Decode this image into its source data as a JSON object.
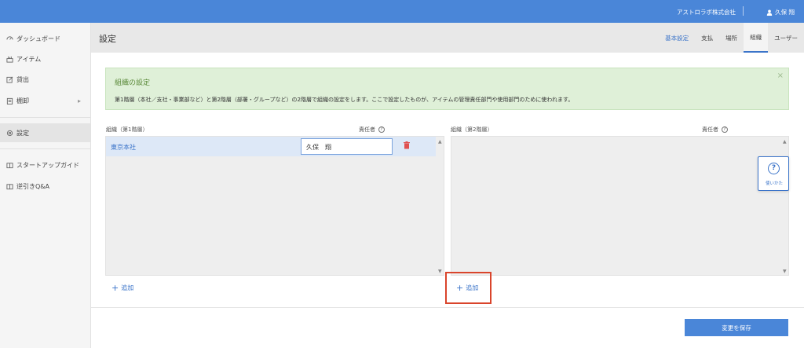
{
  "topbar": {
    "company": "アストロラボ株式会社",
    "user": "久保 翔"
  },
  "sidebar": {
    "items": [
      {
        "label": "ダッシュボード",
        "icon": "dashboard-icon"
      },
      {
        "label": "アイテム",
        "icon": "item-icon"
      },
      {
        "label": "貸出",
        "icon": "edit-icon"
      },
      {
        "label": "棚卸",
        "icon": "clipboard-icon",
        "has_arrow": true
      },
      {
        "label": "設定",
        "icon": "gear-icon",
        "active": true
      },
      {
        "label": "スタートアップガイド",
        "icon": "book-icon"
      },
      {
        "label": "逆引きQ&A",
        "icon": "book-icon"
      }
    ]
  },
  "header": {
    "title": "設定",
    "tabs": [
      {
        "label": "基本設定"
      },
      {
        "label": "支払"
      },
      {
        "label": "場所"
      },
      {
        "label": "組織",
        "active": true
      },
      {
        "label": "ユーザー"
      }
    ]
  },
  "alert": {
    "title": "組織の設定",
    "text": "第1階層（本社／支社・事業部など）と第2階層（部署・グループなど）の2階層で組織の設定をします。ここで設定したものが、アイテムの管理責任部門や使用部門のために使われます。",
    "close": "×"
  },
  "level1": {
    "org_header": "組織（第1階層）",
    "owner_header": "責任者",
    "rows": [
      {
        "name": "東京本社",
        "owner": "久保　翔"
      }
    ],
    "add_label": "追加"
  },
  "level2": {
    "org_header": "組織（第2階層）",
    "owner_header": "責任者",
    "add_label": "追加"
  },
  "help_widget": {
    "label": "使いかた",
    "glyph": "?"
  },
  "save_button": "変更を保存",
  "colors": {
    "primary": "#4a86d8",
    "success_bg": "#dff0d8",
    "highlight": "#d9442b"
  }
}
